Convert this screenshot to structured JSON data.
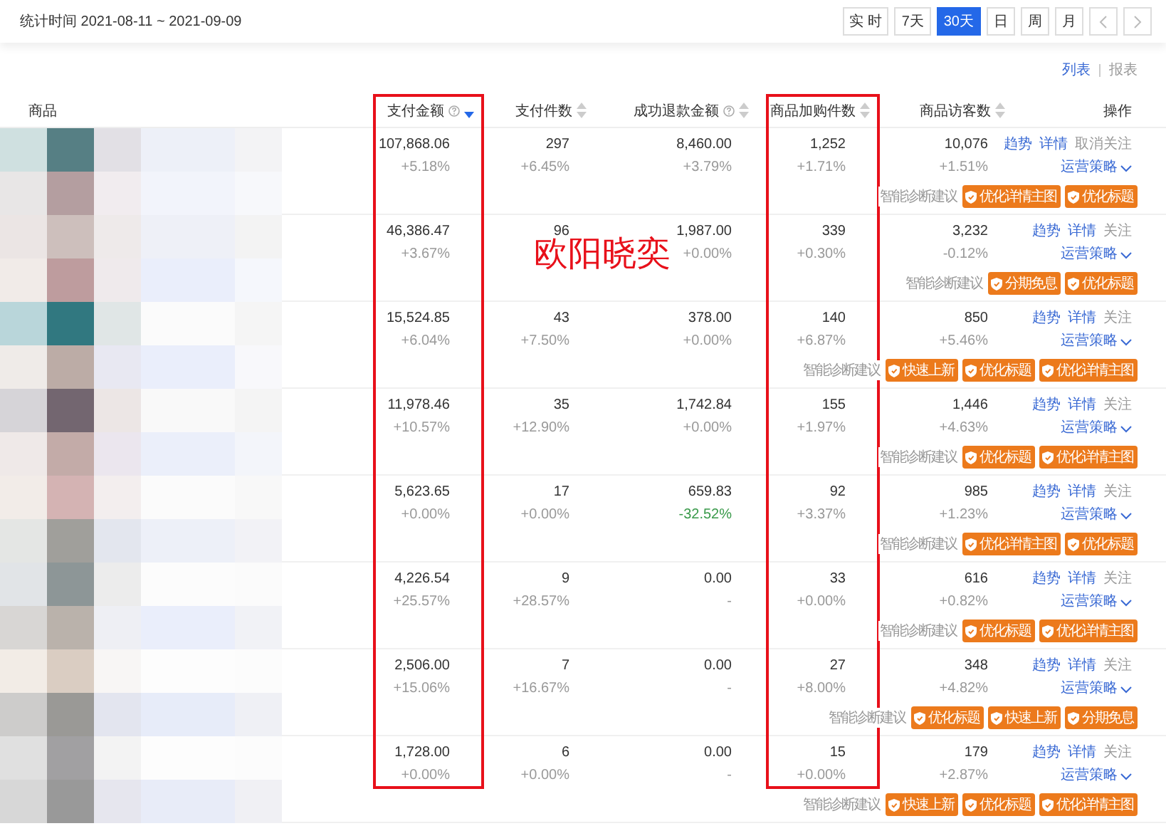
{
  "top_bar": {
    "period_label": "统计时间 2021-08-11 ~ 2021-09-09",
    "ranges": [
      {
        "label": "实 时",
        "selected": false
      },
      {
        "label": "7天",
        "selected": false
      },
      {
        "label": "30天",
        "selected": true
      },
      {
        "label": "日",
        "selected": false
      },
      {
        "label": "周",
        "selected": false
      },
      {
        "label": "月",
        "selected": false
      }
    ]
  },
  "view_switch": [
    {
      "label": "列表",
      "selected": true
    },
    {
      "label": "报表",
      "selected": false
    }
  ],
  "annotation": "欧阳晓奕",
  "columns": [
    {
      "label": "商品",
      "help": false,
      "sortable": false,
      "sorted": false,
      "highlighted": false
    },
    {
      "label": "支付金额",
      "help": true,
      "sortable": true,
      "sorted": true,
      "highlighted": true
    },
    {
      "label": "支付件数",
      "help": false,
      "sortable": true,
      "sorted": false,
      "highlighted": false
    },
    {
      "label": "成功退款金额",
      "help": true,
      "sortable": true,
      "sorted": false,
      "highlighted": false
    },
    {
      "label": "商品加购件数",
      "help": false,
      "sortable": true,
      "sorted": false,
      "highlighted": true
    },
    {
      "label": "商品访客数",
      "help": false,
      "sortable": true,
      "sorted": false,
      "highlighted": false
    },
    {
      "label": "操作",
      "help": false,
      "sortable": false,
      "sorted": false,
      "highlighted": false
    }
  ],
  "rows": [
    {
      "metrics": [
        {
          "value": "107,868.06",
          "change": "+5.18%",
          "color": "#999999"
        },
        {
          "value": "297",
          "change": "+6.45%",
          "color": "#999999"
        },
        {
          "value": "8,460.00",
          "change": "+3.79%",
          "color": "#999999"
        },
        {
          "value": "1,252",
          "change": "+1.71%",
          "color": "#999999"
        },
        {
          "value": "10,076",
          "change": "+1.51%",
          "color": "#999999"
        }
      ],
      "links": [
        "趋势",
        "详情"
      ],
      "follow": "取消关注",
      "strategy": "运营策略",
      "diagnosis_label": "智能诊断建议",
      "suggestions": [
        "优化详情主图",
        "优化标题"
      ]
    },
    {
      "metrics": [
        {
          "value": "46,386.47",
          "change": "+3.67%",
          "color": "#999999"
        },
        {
          "value": "96"
        },
        {
          "value": "1,987.00",
          "change": "+0.00%",
          "color": "#999999"
        },
        {
          "value": "339",
          "change": "+0.30%",
          "color": "#999999"
        },
        {
          "value": "3,232",
          "change": "-0.12%",
          "color": "#999999"
        }
      ],
      "links": [
        "趋势",
        "详情"
      ],
      "follow": "关注",
      "strategy": "运营策略",
      "diagnosis_label": "智能诊断建议",
      "suggestions": [
        "分期免息",
        "优化标题"
      ]
    },
    {
      "metrics": [
        {
          "value": "15,524.85",
          "change": "+6.04%",
          "color": "#999999"
        },
        {
          "value": "43",
          "change": "+7.50%",
          "color": "#999999"
        },
        {
          "value": "378.00",
          "change": "+0.00%",
          "color": "#999999"
        },
        {
          "value": "140",
          "change": "+6.87%",
          "color": "#999999"
        },
        {
          "value": "850",
          "change": "+5.46%",
          "color": "#999999"
        }
      ],
      "links": [
        "趋势",
        "详情"
      ],
      "follow": "关注",
      "strategy": "运营策略",
      "diagnosis_label": "智能诊断建议",
      "suggestions": [
        "快速上新",
        "优化标题",
        "优化详情主图"
      ]
    },
    {
      "metrics": [
        {
          "value": "11,978.46",
          "change": "+10.57%",
          "color": "#999999"
        },
        {
          "value": "35",
          "change": "+12.90%",
          "color": "#999999"
        },
        {
          "value": "1,742.84",
          "change": "+0.00%",
          "color": "#999999"
        },
        {
          "value": "155",
          "change": "+1.97%",
          "color": "#999999"
        },
        {
          "value": "1,446",
          "change": "+4.63%",
          "color": "#999999"
        }
      ],
      "links": [
        "趋势",
        "详情"
      ],
      "follow": "关注",
      "strategy": "运营策略",
      "diagnosis_label": "智能诊断建议",
      "suggestions": [
        "优化标题",
        "优化详情主图"
      ]
    },
    {
      "metrics": [
        {
          "value": "5,623.65",
          "change": "+0.00%",
          "color": "#999999"
        },
        {
          "value": "17",
          "change": "+0.00%",
          "color": "#999999"
        },
        {
          "value": "659.83",
          "change": "-32.52%",
          "color": "#3a9a4b"
        },
        {
          "value": "92",
          "change": "+3.37%",
          "color": "#999999"
        },
        {
          "value": "985",
          "change": "+1.23%",
          "color": "#999999"
        }
      ],
      "links": [
        "趋势",
        "详情"
      ],
      "follow": "关注",
      "strategy": "运营策略",
      "diagnosis_label": "智能诊断建议",
      "suggestions": [
        "优化详情主图",
        "优化标题"
      ]
    },
    {
      "metrics": [
        {
          "value": "4,226.54",
          "change": "+25.57%",
          "color": "#999999"
        },
        {
          "value": "9",
          "change": "+28.57%",
          "color": "#999999"
        },
        {
          "value": "0.00",
          "change": "-",
          "color": "#999999"
        },
        {
          "value": "33",
          "change": "+0.00%",
          "color": "#999999"
        },
        {
          "value": "616",
          "change": "+0.82%",
          "color": "#999999"
        }
      ],
      "links": [
        "趋势",
        "详情"
      ],
      "follow": "关注",
      "strategy": "运营策略",
      "diagnosis_label": "智能诊断建议",
      "suggestions": [
        "优化标题",
        "优化详情主图"
      ]
    },
    {
      "metrics": [
        {
          "value": "2,506.00",
          "change": "+15.06%",
          "color": "#999999"
        },
        {
          "value": "7",
          "change": "+16.67%",
          "color": "#999999"
        },
        {
          "value": "0.00",
          "change": "-",
          "color": "#999999"
        },
        {
          "value": "27",
          "change": "+8.00%",
          "color": "#999999"
        },
        {
          "value": "348",
          "change": "+4.82%",
          "color": "#999999"
        }
      ],
      "links": [
        "趋势",
        "详情"
      ],
      "follow": "关注",
      "strategy": "运营策略",
      "diagnosis_label": "智能诊断建议",
      "suggestions": [
        "优化标题",
        "快速上新",
        "分期免息"
      ]
    },
    {
      "metrics": [
        {
          "value": "1,728.00",
          "change": "+0.00%",
          "color": "#999999"
        },
        {
          "value": "6",
          "change": "+0.00%",
          "color": "#999999"
        },
        {
          "value": "0.00",
          "change": "-",
          "color": "#999999"
        },
        {
          "value": "15",
          "change": "+0.00%",
          "color": "#999999"
        },
        {
          "value": "179",
          "change": "+2.87%",
          "color": "#999999"
        }
      ],
      "links": [
        "趋势",
        "详情"
      ],
      "follow": "关注",
      "strategy": "运营策略",
      "diagnosis_label": "智能诊断建议",
      "suggestions": [
        "快速上新",
        "优化标题",
        "优化详情主图"
      ]
    }
  ]
}
